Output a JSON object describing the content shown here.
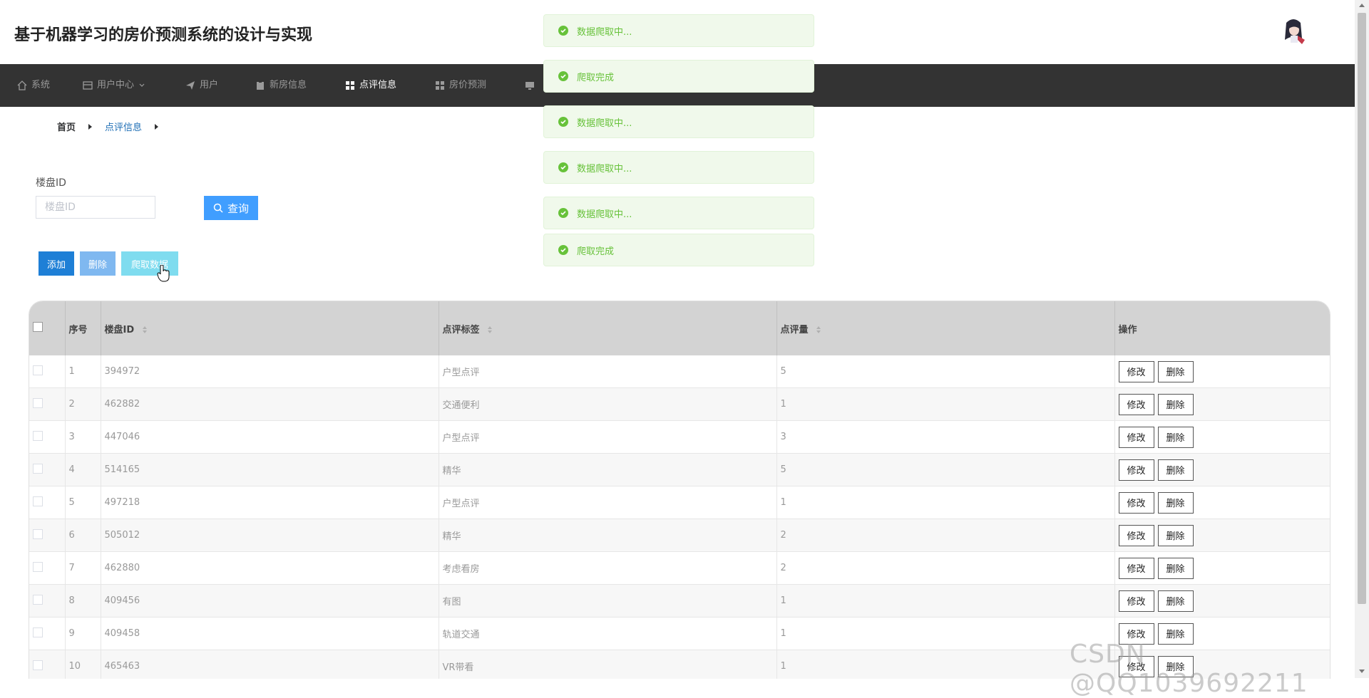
{
  "app": {
    "title": "基于机器学习的房价预测系统的设计与实现"
  },
  "nav": {
    "items": [
      {
        "label": "系统",
        "icon": "home-icon"
      },
      {
        "label": "用户中心",
        "icon": "panel-icon"
      },
      {
        "label": "用户",
        "icon": "send-icon"
      },
      {
        "label": "新房信息",
        "icon": "clipboard-icon"
      },
      {
        "label": "点评信息",
        "icon": "grid-icon"
      },
      {
        "label": "房价预测",
        "icon": "grid-icon"
      }
    ],
    "active": "点评信息"
  },
  "breadcrumb": {
    "home": "首页",
    "current": "点评信息"
  },
  "filter": {
    "label": "楼盘ID",
    "placeholder": "楼盘ID",
    "search_label": "查询"
  },
  "actions": {
    "add": "添加",
    "delete": "删除",
    "crawl": "爬取数据"
  },
  "table": {
    "headers": {
      "index": "序号",
      "building_id": "楼盘ID",
      "tag": "点评标签",
      "count": "点评量",
      "ops": "操作"
    },
    "edit_label": "修改",
    "delete_label": "删除",
    "rows": [
      {
        "index": "1",
        "building_id": "394972",
        "tag": "户型点评",
        "count": "5"
      },
      {
        "index": "2",
        "building_id": "462882",
        "tag": "交通便利",
        "count": "1"
      },
      {
        "index": "3",
        "building_id": "447046",
        "tag": "户型点评",
        "count": "3"
      },
      {
        "index": "4",
        "building_id": "514165",
        "tag": "精华",
        "count": "5"
      },
      {
        "index": "5",
        "building_id": "497218",
        "tag": "户型点评",
        "count": "1"
      },
      {
        "index": "6",
        "building_id": "505012",
        "tag": "精华",
        "count": "2"
      },
      {
        "index": "7",
        "building_id": "462880",
        "tag": "考虑看房",
        "count": "2"
      },
      {
        "index": "8",
        "building_id": "409456",
        "tag": "有图",
        "count": "1"
      },
      {
        "index": "9",
        "building_id": "409458",
        "tag": "轨道交通",
        "count": "1"
      },
      {
        "index": "10",
        "building_id": "465463",
        "tag": "VR带看",
        "count": "1"
      }
    ]
  },
  "toasts": [
    {
      "text": "数据爬取中..."
    },
    {
      "text": "爬取完成"
    },
    {
      "text": "数据爬取中..."
    },
    {
      "text": "数据爬取中..."
    },
    {
      "text": "数据爬取中..."
    },
    {
      "text": "爬取完成"
    }
  ],
  "watermark": "CSDN @QQ1039692211",
  "colors": {
    "nav_bg": "#333333",
    "primary": "#409eff",
    "success": "#67c23a",
    "header_row": "#d3d3d3"
  }
}
